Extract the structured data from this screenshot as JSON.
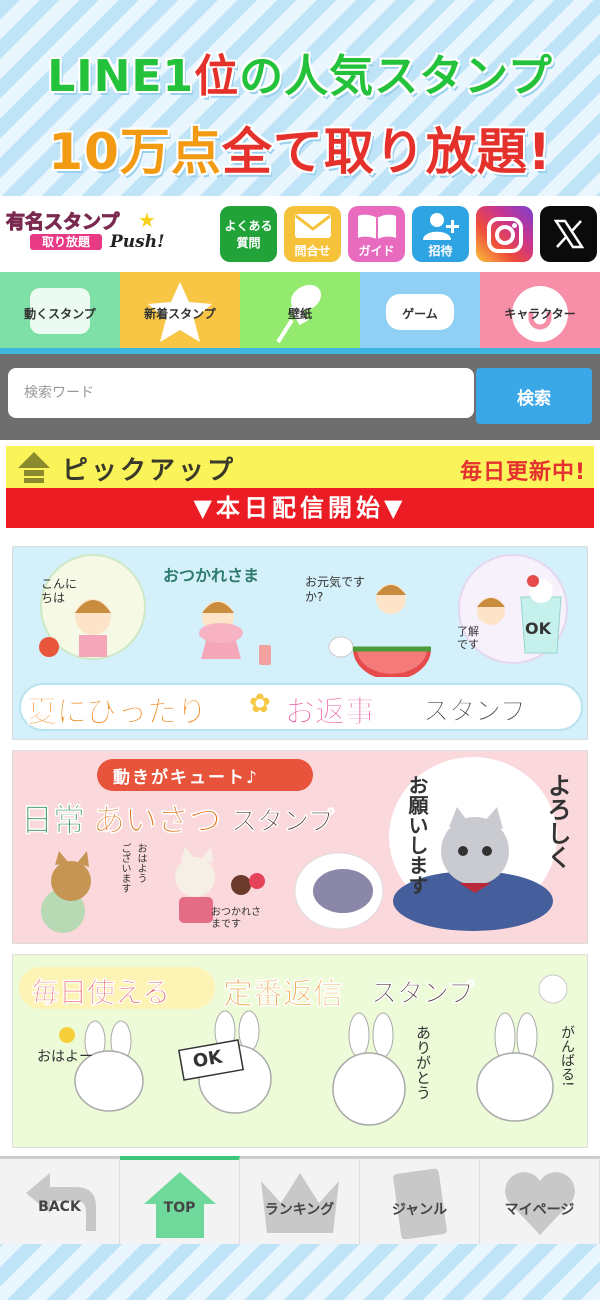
{
  "promo": {
    "line1_a": "LINE1",
    "line1_b": "位",
    "line1_c": "の人気スタンプ",
    "line2_a": "10万点",
    "line2_b": "全て取り放題!"
  },
  "header": {
    "logo_line1": "有名スタンプ",
    "logo_line2": "取り放題",
    "logo_push": "Push!",
    "icons": {
      "faq": "よくある\n質問",
      "contact": "問合せ",
      "guide": "ガイド",
      "invite": "招待"
    }
  },
  "categories": [
    "動くスタンプ",
    "新着スタンプ",
    "壁紙",
    "ゲーム",
    "キャラクター"
  ],
  "search": {
    "placeholder": "検索ワード",
    "button": "検索"
  },
  "pickup": {
    "title": "ピックアップ",
    "daily": "毎日更新中!",
    "today": "▼本日配信開始▼"
  },
  "banners": [
    {
      "title_a": "夏にぴったり",
      "title_b": "お返事",
      "title_c": "スタンプ",
      "bubbles": [
        "こんにちは",
        "おつかれさま",
        "お元気ですか?",
        "了解です",
        "OK"
      ]
    },
    {
      "tag": "動きがキュート♪",
      "title_a": "日常",
      "title_b": "あいさつ",
      "title_c": "スタンプ",
      "bubbles": [
        "よろしく",
        "お願いします",
        "おはよう",
        "ございます",
        "おつかれさまです"
      ]
    },
    {
      "title_a": "毎日使える",
      "title_b": "定番返信",
      "title_c": "スタンプ",
      "bubbles": [
        "おはよー",
        "OK",
        "ありがとう",
        "がんばる!"
      ]
    }
  ],
  "nav": [
    "BACK",
    "TOP",
    "ランキング",
    "ジャンル",
    "マイページ"
  ],
  "colors": {
    "accent_blue": "#3aa7e6",
    "red": "#ec1c24",
    "yellow": "#fbf35a",
    "green": "#3cc77a"
  }
}
